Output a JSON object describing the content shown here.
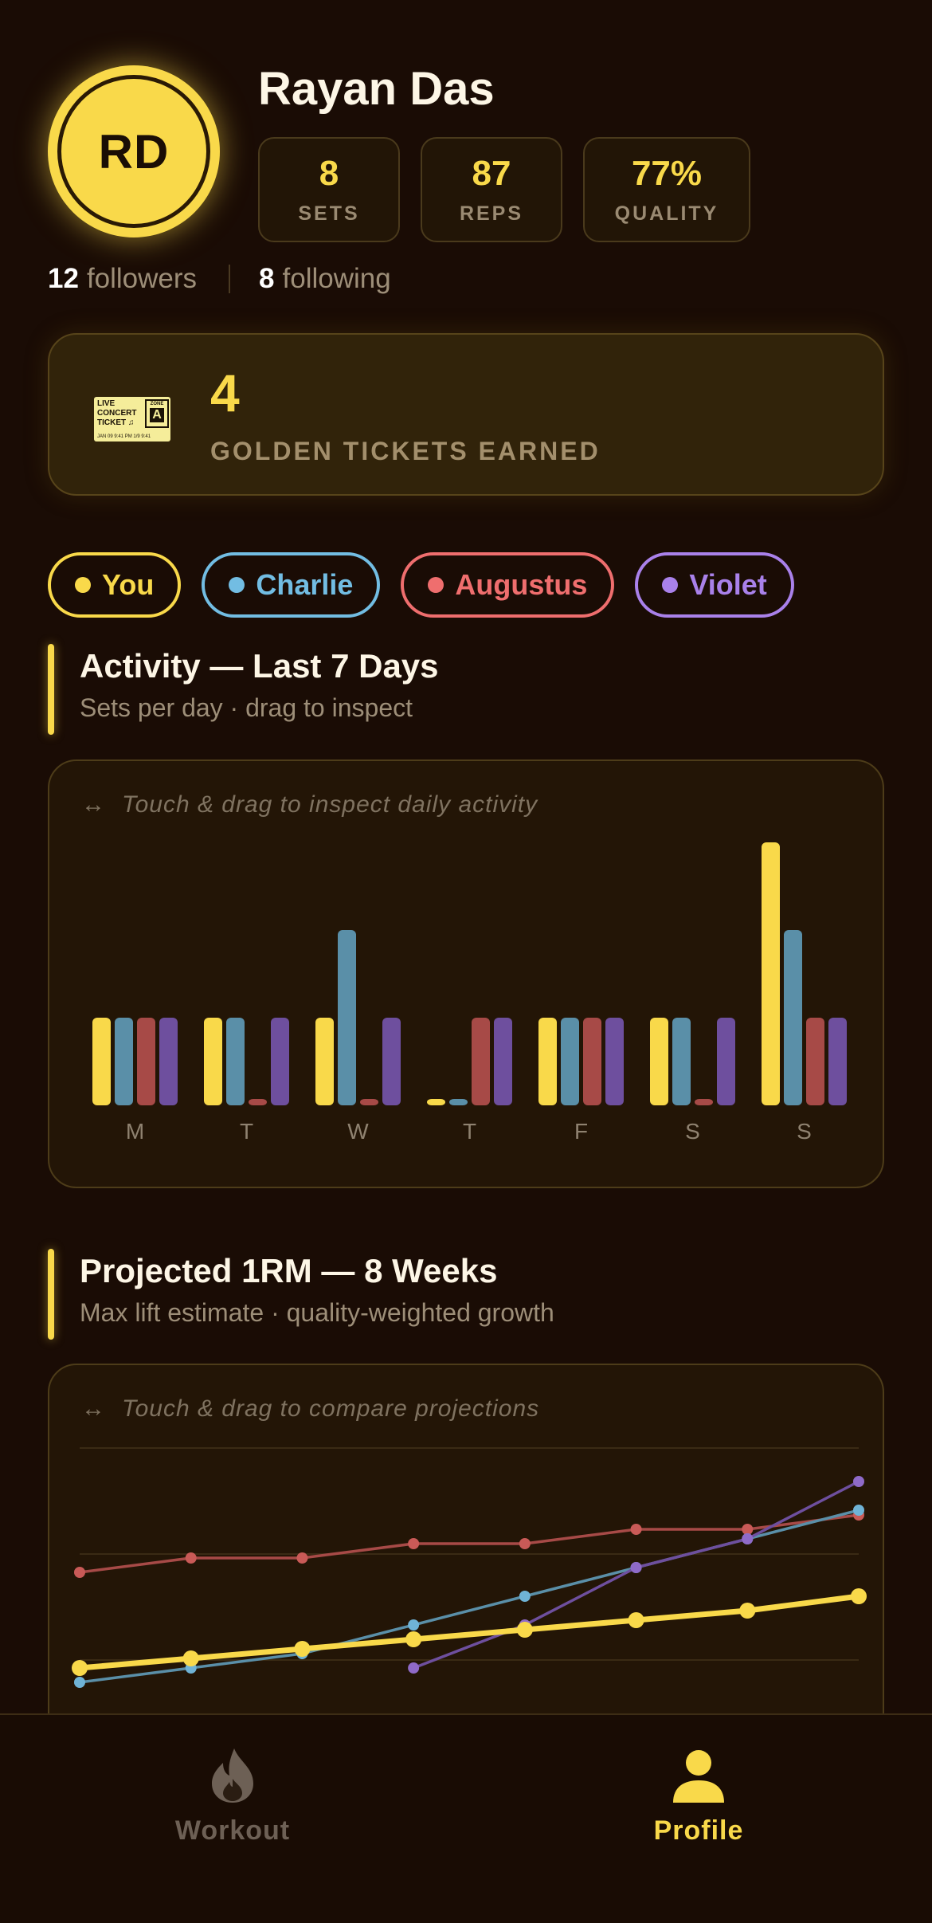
{
  "profile": {
    "initials": "RD",
    "name": "Rayan Das",
    "stats": [
      {
        "value": "8",
        "label": "SETS"
      },
      {
        "value": "87",
        "label": "REPS"
      },
      {
        "value": "77%",
        "label": "QUALITY"
      }
    ],
    "followers_count": "12",
    "followers_label": "followers",
    "following_count": "8",
    "following_label": "following"
  },
  "tickets": {
    "count": "4",
    "label": "GOLDEN TICKETS EARNED",
    "icon": "golden-ticket-icon",
    "icon_text": {
      "line1": "LIVE",
      "line2": "CONCERT",
      "line3": "TICKET ♫",
      "zone": "ZONE",
      "zone_letter": "A",
      "footer": "JAN 09  9:41 PM   1/9  9:41"
    }
  },
  "filters": [
    {
      "label": "You",
      "color": "#f9d94a"
    },
    {
      "label": "Charlie",
      "color": "#72bde3"
    },
    {
      "label": "Augustus",
      "color": "#ef6e6e"
    },
    {
      "label": "Violet",
      "color": "#a981ea"
    }
  ],
  "activity": {
    "title": "Activity — Last 7 Days",
    "subtitle": "Sets per day · drag to inspect",
    "hint": "Touch & drag to inspect daily activity",
    "hint_icon": "↔"
  },
  "projection": {
    "title": "Projected 1RM — 8 Weeks",
    "subtitle": "Max lift estimate · quality-weighted growth",
    "hint": "Touch & drag to compare projections",
    "hint_icon": "↔"
  },
  "nav": {
    "items": [
      {
        "label": "Workout",
        "icon": "flame-icon",
        "active": false
      },
      {
        "label": "Profile",
        "icon": "person-icon",
        "active": true
      }
    ]
  },
  "colors": {
    "accent": "#f9d94a",
    "you": "#f9d94a",
    "charlie": "#5a8fa8",
    "augustus": "#a74a47",
    "violet": "#6e4f9e",
    "background": "#1a0c05"
  },
  "chart_data": [
    {
      "type": "bar",
      "categories": [
        "M",
        "T",
        "W",
        "T",
        "F",
        "S",
        "S"
      ],
      "series": [
        {
          "name": "You",
          "values": [
            2,
            2,
            2,
            0,
            2,
            2,
            6
          ]
        },
        {
          "name": "Charlie",
          "values": [
            2,
            2,
            4,
            0,
            2,
            2,
            4
          ]
        },
        {
          "name": "Augustus",
          "values": [
            2,
            0,
            0,
            2,
            2,
            0,
            2
          ]
        },
        {
          "name": "Violet",
          "values": [
            2,
            2,
            2,
            2,
            2,
            2,
            2
          ]
        }
      ],
      "ylim": [
        0,
        6
      ],
      "grid": false
    },
    {
      "type": "line",
      "x": [
        1,
        2,
        3,
        4,
        5,
        6,
        7,
        8
      ],
      "series": [
        {
          "name": "You",
          "values": [
            60,
            62,
            64,
            66,
            68,
            70,
            72,
            75
          ]
        },
        {
          "name": "Charlie",
          "values": [
            57,
            60,
            63,
            69,
            75,
            81,
            87,
            93
          ]
        },
        {
          "name": "Augustus",
          "values": [
            80,
            83,
            83,
            86,
            86,
            89,
            89,
            92
          ]
        },
        {
          "name": "Violet",
          "values": [
            null,
            null,
            null,
            60,
            69,
            81,
            87,
            99
          ]
        }
      ],
      "ylim": [
        50,
        106
      ],
      "grid": true
    }
  ]
}
